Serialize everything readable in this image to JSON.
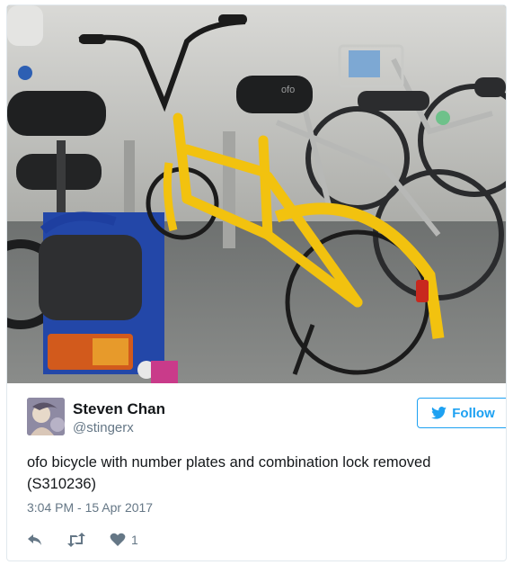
{
  "tweet": {
    "author_name": "Steven Chan",
    "author_handle": "@stingerx",
    "follow_label": "Follow",
    "text": "ofo bicycle with number plates and combination lock removed (S310236)",
    "timestamp": "3:04 PM - 15 Apr 2017",
    "like_count": "1"
  },
  "photo": {
    "seat_brand": "ofo"
  },
  "colors": {
    "accent": "#1da1f2",
    "text": "#14171a",
    "muted": "#657786",
    "bike_yellow": "#f2c20f"
  },
  "icons": {
    "follow": "twitter-bird-icon",
    "reply": "reply-icon",
    "retweet": "retweet-icon",
    "like": "heart-icon"
  }
}
